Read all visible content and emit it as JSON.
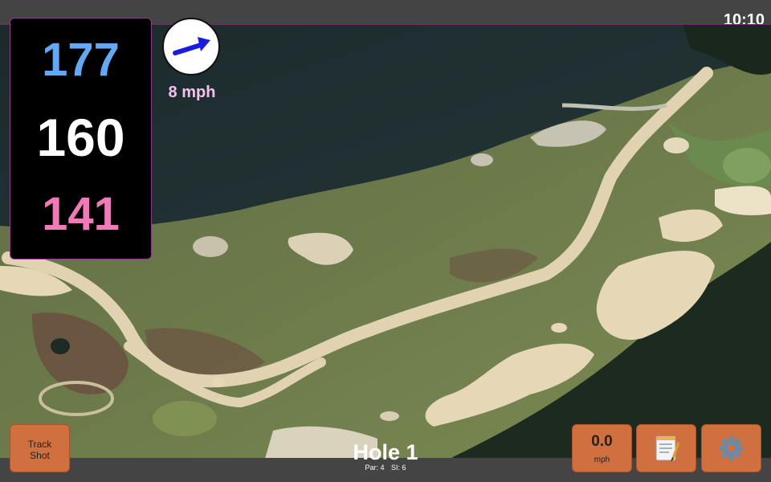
{
  "status": {
    "time": "10:10"
  },
  "distances": {
    "back": "177",
    "middle": "160",
    "front": "141",
    "colors": {
      "back": "#63a8f2",
      "middle": "#ffffff",
      "front": "#f07ab8"
    }
  },
  "wind": {
    "speed_label": "8 mph",
    "arrow_icon": "wind-arrow-icon"
  },
  "buttons": {
    "track_shot_line1": "Track",
    "track_shot_line2": "Shot",
    "speed_value": "0.0",
    "speed_unit": "mph",
    "notes_icon": "notepad-icon",
    "settings_icon": "gear-icon",
    "accent": "#d0703f"
  },
  "hole": {
    "title": "Hole 1",
    "par_label": "Par: 4",
    "si_label": "SI: 6"
  },
  "map": {
    "icon": "satellite-map",
    "water": "#1f2d2d",
    "fairway": "#6e7a4c",
    "sand": "#e6d8b6"
  }
}
